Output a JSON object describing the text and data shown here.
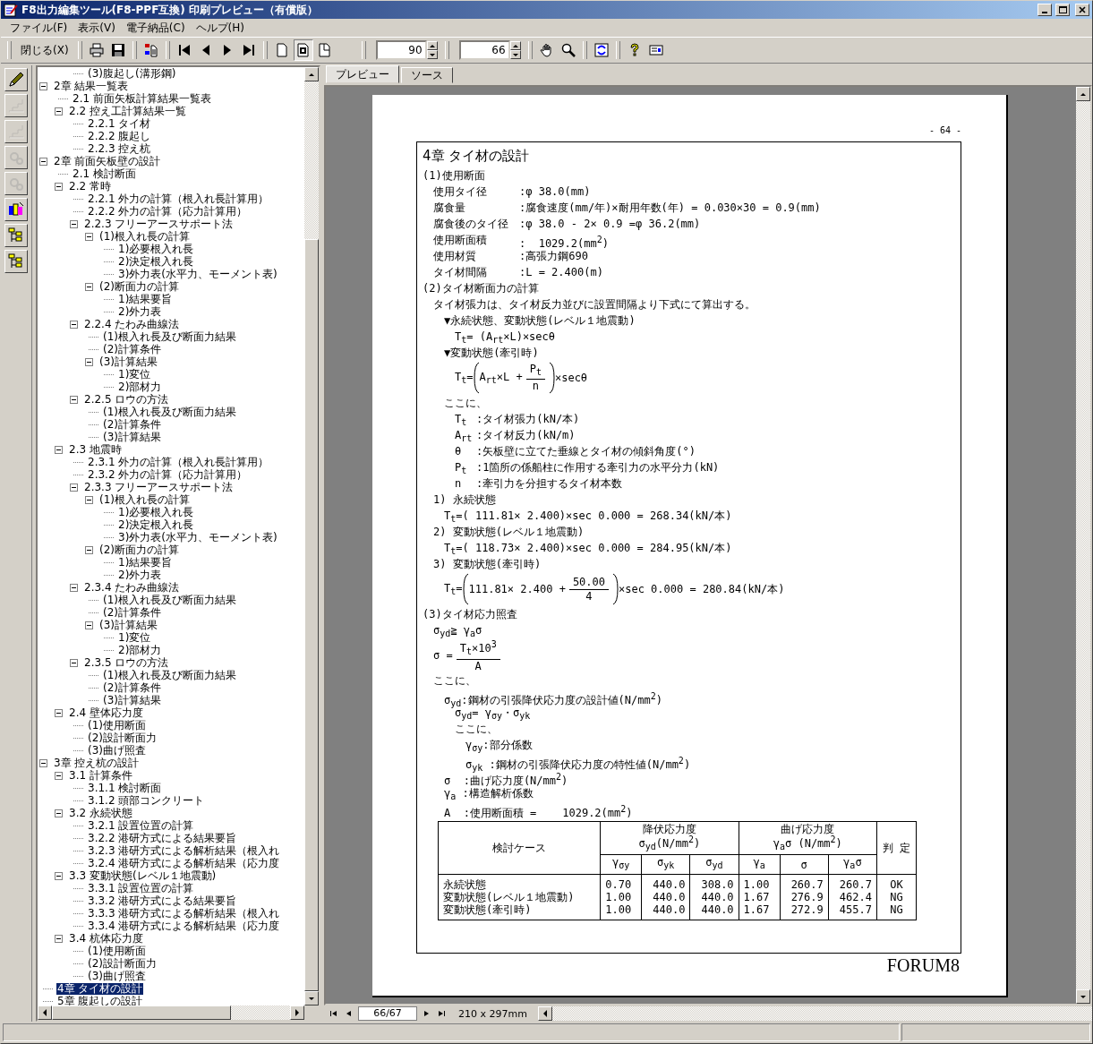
{
  "window": {
    "title": "F8出力編集ツール(F8-PPF互換) 印刷プレビュー（有償版）"
  },
  "menu": [
    {
      "label": "ファイル(F)"
    },
    {
      "label": "表示(V)"
    },
    {
      "label": "電子納品(C)"
    },
    {
      "label": "ヘルプ(H)"
    }
  ],
  "toolbar": {
    "close_label": "閉じる(X)",
    "zoom": {
      "value": "90"
    },
    "page": {
      "value": "66"
    },
    "page_views": [
      {
        "selected": false
      },
      {
        "selected": true
      },
      {
        "selected": false
      }
    ]
  },
  "side_tools": [
    {
      "kind": "pencil",
      "disabled": false
    },
    {
      "kind": "stairs",
      "disabled": true
    },
    {
      "kind": "stairs",
      "disabled": true
    },
    {
      "kind": "gears",
      "disabled": true
    },
    {
      "kind": "gears",
      "disabled": true
    },
    {
      "kind": "numbers",
      "disabled": false
    },
    {
      "kind": "tree",
      "disabled": false
    },
    {
      "kind": "tree",
      "disabled": false
    }
  ],
  "tree": {
    "items": [
      {
        "children": [
          {
            "children": [
              {
                "label": "(3)腹起し(溝形鋼)",
                "selected": false
              }
            ]
          }
        ]
      },
      {
        "label": "2章 結果一覧表",
        "selected": false,
        "expanded": true,
        "children": [
          {
            "label": "2.1 前面矢板計算結果一覧表",
            "selected": false
          },
          {
            "label": "2.2 控え工計算結果一覧",
            "selected": false,
            "expanded": true,
            "children": [
              {
                "label": "2.2.1 タイ材",
                "selected": false
              },
              {
                "label": "2.2.2 腹起し",
                "selected": false
              },
              {
                "label": "2.2.3 控え杭",
                "selected": false
              }
            ]
          }
        ]
      },
      {
        "label": "2章 前面矢板壁の設計",
        "selected": false,
        "expanded": true,
        "children": [
          {
            "label": "2.1 検討断面",
            "selected": false
          },
          {
            "label": "2.2 常時",
            "selected": false,
            "expanded": true,
            "children": [
              {
                "label": "2.2.1 外力の計算（根入れ長計算用）",
                "selected": false
              },
              {
                "label": "2.2.2 外力の計算（応力計算用）",
                "selected": false
              },
              {
                "label": "2.2.3 フリーアースサポート法",
                "selected": false,
                "expanded": true,
                "children": [
                  {
                    "label": "(1)根入れ長の計算",
                    "selected": false,
                    "expanded": true,
                    "children": [
                      {
                        "label": "1)必要根入れ長",
                        "selected": false
                      },
                      {
                        "label": "2)決定根入れ長",
                        "selected": false
                      },
                      {
                        "label": "3)外力表(水平力、モーメント表)",
                        "selected": false
                      }
                    ]
                  },
                  {
                    "label": "(2)断面力の計算",
                    "selected": false,
                    "expanded": true,
                    "children": [
                      {
                        "label": "1)結果要旨",
                        "selected": false
                      },
                      {
                        "label": "2)外力表",
                        "selected": false
                      }
                    ]
                  }
                ]
              },
              {
                "label": "2.2.4 たわみ曲線法",
                "selected": false,
                "expanded": true,
                "children": [
                  {
                    "label": "(1)根入れ長及び断面力結果",
                    "selected": false
                  },
                  {
                    "label": "(2)計算条件",
                    "selected": false
                  },
                  {
                    "label": "(3)計算結果",
                    "selected": false,
                    "expanded": true,
                    "children": [
                      {
                        "label": "1)変位",
                        "selected": false
                      },
                      {
                        "label": "2)部材力",
                        "selected": false
                      }
                    ]
                  }
                ]
              },
              {
                "label": "2.2.5 ロウの方法",
                "selected": false,
                "expanded": true,
                "children": [
                  {
                    "label": "(1)根入れ長及び断面力結果",
                    "selected": false
                  },
                  {
                    "label": "(2)計算条件",
                    "selected": false
                  },
                  {
                    "label": "(3)計算結果",
                    "selected": false
                  }
                ]
              }
            ]
          },
          {
            "label": "2.3 地震時",
            "selected": false,
            "expanded": true,
            "children": [
              {
                "label": "2.3.1 外力の計算（根入れ長計算用）",
                "selected": false
              },
              {
                "label": "2.3.2 外力の計算（応力計算用）",
                "selected": false
              },
              {
                "label": "2.3.3 フリーアースサポート法",
                "selected": false,
                "expanded": true,
                "children": [
                  {
                    "label": "(1)根入れ長の計算",
                    "selected": false,
                    "expanded": true,
                    "children": [
                      {
                        "label": "1)必要根入れ長",
                        "selected": false
                      },
                      {
                        "label": "2)決定根入れ長",
                        "selected": false
                      },
                      {
                        "label": "3)外力表(水平力、モーメント表)",
                        "selected": false
                      }
                    ]
                  },
                  {
                    "label": "(2)断面力の計算",
                    "selected": false,
                    "expanded": true,
                    "children": [
                      {
                        "label": "1)結果要旨",
                        "selected": false
                      },
                      {
                        "label": "2)外力表",
                        "selected": false
                      }
                    ]
                  }
                ]
              },
              {
                "label": "2.3.4 たわみ曲線法",
                "selected": false,
                "expanded": true,
                "children": [
                  {
                    "label": "(1)根入れ長及び断面力結果",
                    "selected": false
                  },
                  {
                    "label": "(2)計算条件",
                    "selected": false
                  },
                  {
                    "label": "(3)計算結果",
                    "selected": false,
                    "expanded": true,
                    "children": [
                      {
                        "label": "1)変位",
                        "selected": false
                      },
                      {
                        "label": "2)部材力",
                        "selected": false
                      }
                    ]
                  }
                ]
              },
              {
                "label": "2.3.5 ロウの方法",
                "selected": false,
                "expanded": true,
                "children": [
                  {
                    "label": "(1)根入れ長及び断面力結果",
                    "selected": false
                  },
                  {
                    "label": "(2)計算条件",
                    "selected": false
                  },
                  {
                    "label": "(3)計算結果",
                    "selected": false
                  }
                ]
              }
            ]
          },
          {
            "label": "2.4 壁体応力度",
            "selected": false,
            "expanded": true,
            "children": [
              {
                "label": "(1)使用断面",
                "selected": false
              },
              {
                "label": "(2)設計断面力",
                "selected": false
              },
              {
                "label": "(3)曲げ照査",
                "selected": false
              }
            ]
          }
        ]
      },
      {
        "label": "3章 控え杭の設計",
        "selected": false,
        "expanded": true,
        "children": [
          {
            "label": "3.1 計算条件",
            "selected": false,
            "expanded": true,
            "children": [
              {
                "label": "3.1.1 検討断面",
                "selected": false
              },
              {
                "label": "3.1.2 頭部コンクリート",
                "selected": false
              }
            ]
          },
          {
            "label": "3.2 永続状態",
            "selected": false,
            "expanded": true,
            "children": [
              {
                "label": "3.2.1 設置位置の計算",
                "selected": false
              },
              {
                "label": "3.2.2 港研方式による結果要旨",
                "selected": false
              },
              {
                "label": "3.2.3 港研方式による解析結果（根入れ",
                "selected": false
              },
              {
                "label": "3.2.4 港研方式による解析結果（応力度",
                "selected": false
              }
            ]
          },
          {
            "label": "3.3 変動状態(レベル１地震動)",
            "selected": false,
            "expanded": true,
            "children": [
              {
                "label": "3.3.1 設置位置の計算",
                "selected": false
              },
              {
                "label": "3.3.2 港研方式による結果要旨",
                "selected": false
              },
              {
                "label": "3.3.3 港研方式による解析結果（根入れ",
                "selected": false
              },
              {
                "label": "3.3.4 港研方式による解析結果（応力度",
                "selected": false
              }
            ]
          },
          {
            "label": "3.4 杭体応力度",
            "selected": false,
            "expanded": true,
            "children": [
              {
                "label": "(1)使用断面",
                "selected": false
              },
              {
                "label": "(2)設計断面力",
                "selected": false
              },
              {
                "label": "(3)曲げ照査",
                "selected": false
              }
            ]
          }
        ]
      },
      {
        "label": "4章 タイ材の設計",
        "selected": true
      },
      {
        "label": "5章 腹起しの設計",
        "selected": false
      }
    ]
  },
  "tabs": [
    {
      "label": "プレビュー",
      "selected": true
    },
    {
      "label": "ソース",
      "selected": false
    }
  ],
  "document": {
    "page_number": "- 64 -",
    "lines": [
      {
        "kind": "title",
        "text": "4章 タイ材の設計"
      },
      {
        "kind": "heading",
        "text": "(1)使用断面",
        "children": [
          {
            "kind": "field",
            "label": "使用タイ径",
            "value": ":φ 38.0(mm)"
          },
          {
            "kind": "field",
            "label": "腐食量",
            "value": ":腐食速度(mm/年)×耐用年数(年) = 0.030×30 = 0.9(mm)"
          },
          {
            "kind": "field",
            "label": "腐食後のタイ径",
            "value": ":φ 38.0 - 2× 0.9 =φ 36.2(mm)"
          },
          {
            "kind": "field",
            "label": "使用断面積",
            "value": ":  1029.2(mm$^{2}$)"
          },
          {
            "kind": "field",
            "label": "使用材質",
            "value": ":高張力鋼690"
          },
          {
            "kind": "field",
            "label": "タイ材間隔",
            "value": ":L = 2.400(m)"
          }
        ]
      },
      {
        "kind": "heading",
        "text": "(2)タイ材断面力の計算",
        "children": [
          {
            "kind": "text",
            "text": "タイ材張力は、タイ材反力並びに設置間隔より下式にて算出する。",
            "children": [
              {
                "kind": "text",
                "text": "▼永続状態、変動状態(レベル１地震動)",
                "children": [
                  {
                    "kind": "text",
                    "text": "T$_{t}$= (A$_{rt}$×L)×secθ"
                  }
                ]
              },
              {
                "kind": "text",
                "text": "▼変動状態(牽引時)",
                "children": [
                  {
                    "kind": "fraction",
                    "lhs": "T$_{t}$=",
                    "brackets": true,
                    "before": "A$_{rt}$×L +",
                    "numerator": "P$_{t}$",
                    "denominator": "n",
                    "after": "×secθ"
                  }
                ]
              },
              {
                "kind": "text",
                "text": "ここに、",
                "children": [
                  {
                    "kind": "def",
                    "label": "T$_{t}$",
                    "value": ":タイ材張力(kN/本)"
                  },
                  {
                    "kind": "def",
                    "label": "A$_{rt}$",
                    "value": ":タイ材反力(kN/m)"
                  },
                  {
                    "kind": "def",
                    "label": "θ",
                    "value": ":矢板壁に立てた垂線とタイ材の傾斜角度(°)"
                  },
                  {
                    "kind": "def",
                    "label": "P$_{t}$",
                    "value": ":1箇所の係船柱に作用する牽引力の水平分力(kN)"
                  },
                  {
                    "kind": "def",
                    "label": "n",
                    "value": ":牽引力を分担するタイ材本数"
                  }
                ]
              }
            ]
          },
          {
            "kind": "text",
            "text": "1) 永続状態",
            "children": [
              {
                "kind": "text",
                "text": "T$_{t}$=( 111.81× 2.400)×sec 0.000 = 268.34(kN/本)"
              }
            ]
          },
          {
            "kind": "text",
            "text": "2) 変動状態(レベル１地震動)",
            "children": [
              {
                "kind": "text",
                "text": "T$_{t}$=( 118.73× 2.400)×sec 0.000 = 284.95(kN/本)"
              }
            ]
          },
          {
            "kind": "text",
            "text": "3) 変動状態(牽引時)",
            "children": [
              {
                "kind": "fraction",
                "lhs": "T$_{t}$=",
                "brackets": true,
                "before": "111.81× 2.400 +",
                "numerator": "50.00",
                "denominator": "4",
                "after": "×sec 0.000 = 280.84(kN/本)"
              }
            ]
          }
        ]
      },
      {
        "kind": "heading",
        "text": "(3)タイ材応力照査",
        "children": [
          {
            "kind": "text",
            "text": "σ$_{yd}$≧ γ$_{a}$σ"
          },
          {
            "kind": "fraction",
            "lhs": "σ =",
            "brackets": false,
            "numerator": "T$_{t}$×10$^{3}$",
            "denominator": "A"
          },
          {
            "kind": "text",
            "text": "ここに、",
            "children": [
              {
                "kind": "text",
                "text": "σ$_{yd}$:鋼材の引張降伏応力度の設計値(N/mm$^{2}$)",
                "children": [
                  {
                    "kind": "text",
                    "text": "σ$_{yd}$= γ$_{σy}$・σ$_{yk}$"
                  },
                  {
                    "kind": "text",
                    "text": "ここに、",
                    "children": [
                      {
                        "kind": "text",
                        "text": "γ$_{σy}$:部分係数"
                      },
                      {
                        "kind": "text",
                        "text": "σ$_{yk}$ :鋼材の引張降伏応力度の特性値(N/mm$^{2}$)"
                      }
                    ]
                  }
                ]
              },
              {
                "kind": "text",
                "text": "σ  :曲げ応力度(N/mm$^{2}$)"
              },
              {
                "kind": "text",
                "text": "γ$_{a}$ :構造解析係数"
              },
              {
                "kind": "text",
                "text": "A  :使用断面積 =    1029.2(mm$^{2}$)"
              }
            ]
          }
        ]
      }
    ],
    "table": {
      "columns": [
        {
          "label": "検討ケース"
        },
        {
          "label": "降伏応力度",
          "colspan": 3,
          "unit": "σ$_{yd}$(N/mm$^{2}$)",
          "sub": [
            "γ$_{σy}$",
            "σ$_{yk}$",
            "σ$_{yd}$"
          ]
        },
        {
          "label": "曲げ応力度",
          "colspan": 3,
          "unit": "γ$_{a}$σ  (N/mm$^{2}$)",
          "sub": [
            "γ$_{a}$",
            "σ",
            "γ$_{a}$σ"
          ]
        },
        {
          "label": "判 定"
        }
      ],
      "rows": [
        {
          "cells": [
            "永続状態",
            "0.70",
            "440.0",
            "308.0",
            "1.00",
            "260.7",
            "260.7",
            "OK"
          ]
        },
        {
          "cells": [
            "変動状態(レベル１地震動)",
            "1.00",
            "440.0",
            "440.0",
            "1.67",
            "276.9",
            "462.4",
            "NG"
          ]
        },
        {
          "cells": [
            "変動状態(牽引時)",
            "1.00",
            "440.0",
            "440.0",
            "1.67",
            "272.9",
            "455.7",
            "NG"
          ]
        }
      ]
    },
    "footer": "FORUM8"
  },
  "navigator": {
    "page": {
      "value": "66/67"
    },
    "paper": "210 x 297mm"
  }
}
